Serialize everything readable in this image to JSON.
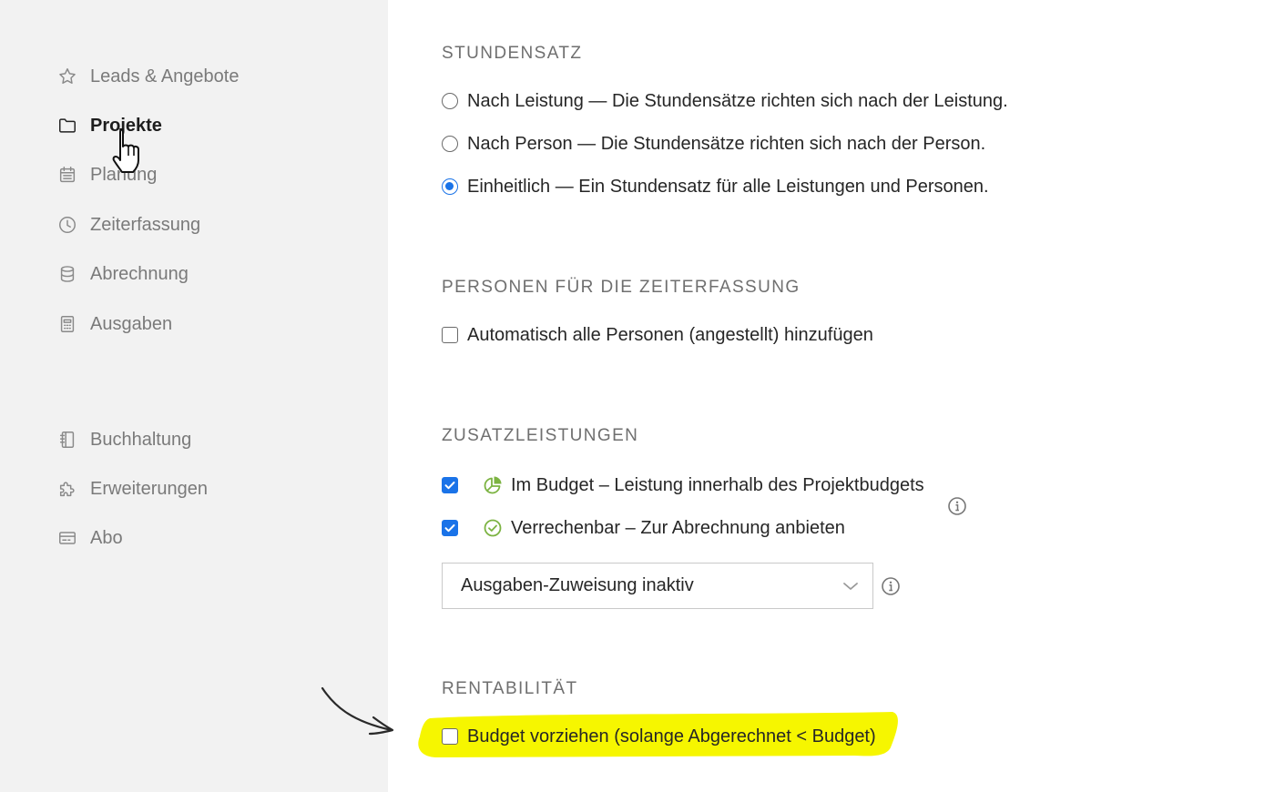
{
  "sidebar": {
    "items": [
      {
        "label": "Leads & Angebote",
        "icon": "star-icon"
      },
      {
        "label": "Projekte",
        "icon": "folder-icon",
        "active": true
      },
      {
        "label": "Planung",
        "icon": "calendar-icon"
      },
      {
        "label": "Zeiterfassung",
        "icon": "clock-icon"
      },
      {
        "label": "Abrechnung",
        "icon": "database-icon"
      },
      {
        "label": "Ausgaben",
        "icon": "calculator-icon"
      }
    ],
    "bottom_items": [
      {
        "label": "Buchhaltung",
        "icon": "ledger-icon"
      },
      {
        "label": "Erweiterungen",
        "icon": "puzzle-icon"
      },
      {
        "label": "Abo",
        "icon": "credit-card-icon"
      }
    ]
  },
  "stundensatz": {
    "title": "Stundensatz",
    "options": [
      {
        "label": "Nach Leistung — Die Stundensätze richten sich nach der Leistung.",
        "checked": false
      },
      {
        "label": "Nach Person — Die Stundensätze richten sich nach der Person.",
        "checked": false
      },
      {
        "label": "Einheitlich — Ein Stundensatz für alle Leistungen und Personen.",
        "checked": true
      }
    ]
  },
  "personen": {
    "title": "Personen für die Zeiterfassung",
    "checkbox_label": "Automatisch alle Personen (angestellt) hinzufügen",
    "checked": false
  },
  "zusatzleistungen": {
    "title": "Zusatzleistungen",
    "im_budget": {
      "label": "Im Budget – Leistung innerhalb des Projektbudgets",
      "checked": true,
      "icon": "pie-chart-icon"
    },
    "verrechenbar": {
      "label": "Verrechenbar – Zur Abrechnung anbieten",
      "checked": true,
      "icon": "check-circle-icon"
    },
    "select_value": "Ausgaben-Zuweisung inaktiv"
  },
  "rentabilitaet": {
    "title": "Rentabilität",
    "checkbox_label": "Budget vorziehen (solange Abgerechnet < Budget)",
    "checked": false
  },
  "colors": {
    "accent": "#1a73e8",
    "sidebar_bg": "#f2f2f2",
    "green_icon": "#7cb342",
    "highlight": "#f6f600"
  }
}
